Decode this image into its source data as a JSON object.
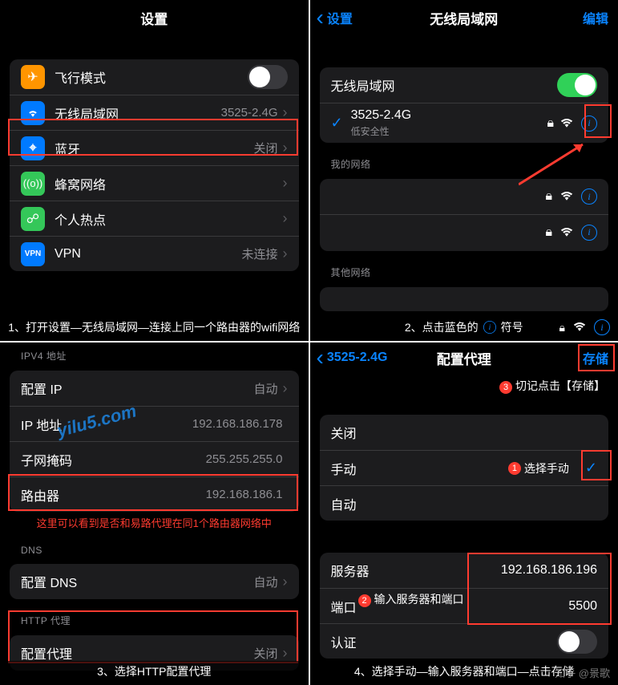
{
  "p1": {
    "title": "设置",
    "rows": {
      "airplane": "飞行模式",
      "wifi": "无线局域网",
      "wifi_val": "3525-2.4G",
      "bt": "蓝牙",
      "bt_val": "关闭",
      "cell": "蜂窝网络",
      "hotspot": "个人热点",
      "vpn": "VPN",
      "vpn_val": "未连接"
    },
    "caption": "1、打开设置—无线局域网—连接上同一个路由器的wifi网络"
  },
  "p2": {
    "back": "设置",
    "title": "无线局域网",
    "edit": "编辑",
    "wifi_label": "无线局域网",
    "net_name": "3525-2.4G",
    "net_sub": "低安全性",
    "my_net": "我的网络",
    "other_net": "其他网络",
    "caption_pre": "2、点击蓝色的",
    "caption_post": " 符号"
  },
  "p3": {
    "sec_ipv4": "IPV4 地址",
    "ip_cfg": "配置 IP",
    "ip_cfg_val": "自动",
    "ip_addr": "IP 地址",
    "ip_addr_val": "192.168.186.178",
    "mask": "子网掩码",
    "mask_val": "255.255.255.0",
    "router": "路由器",
    "router_val": "192.168.186.1",
    "note": "这里可以看到是否和易路代理在同1个路由器网络中",
    "sec_dns": "DNS",
    "dns_cfg": "配置 DNS",
    "dns_val": "自动",
    "sec_http": "HTTP 代理",
    "proxy": "配置代理",
    "proxy_val": "关闭",
    "caption": "3、选择HTTP配置代理",
    "watermark": "yilu5.com"
  },
  "p4": {
    "back": "3525-2.4G",
    "title": "配置代理",
    "save": "存储",
    "note_save": "切记点击【存储】",
    "off": "关闭",
    "manual": "手动",
    "manual_tip": "选择手动",
    "auto": "自动",
    "server": "服务器",
    "server_val": "192.168.186.196",
    "port": "端口",
    "port_val": "5500",
    "input_tip": "输入服务器和端口",
    "auth": "认证",
    "caption": "4、选择手动—输入服务器和端口—点击存储",
    "watermark": "知乎 @景歌"
  }
}
